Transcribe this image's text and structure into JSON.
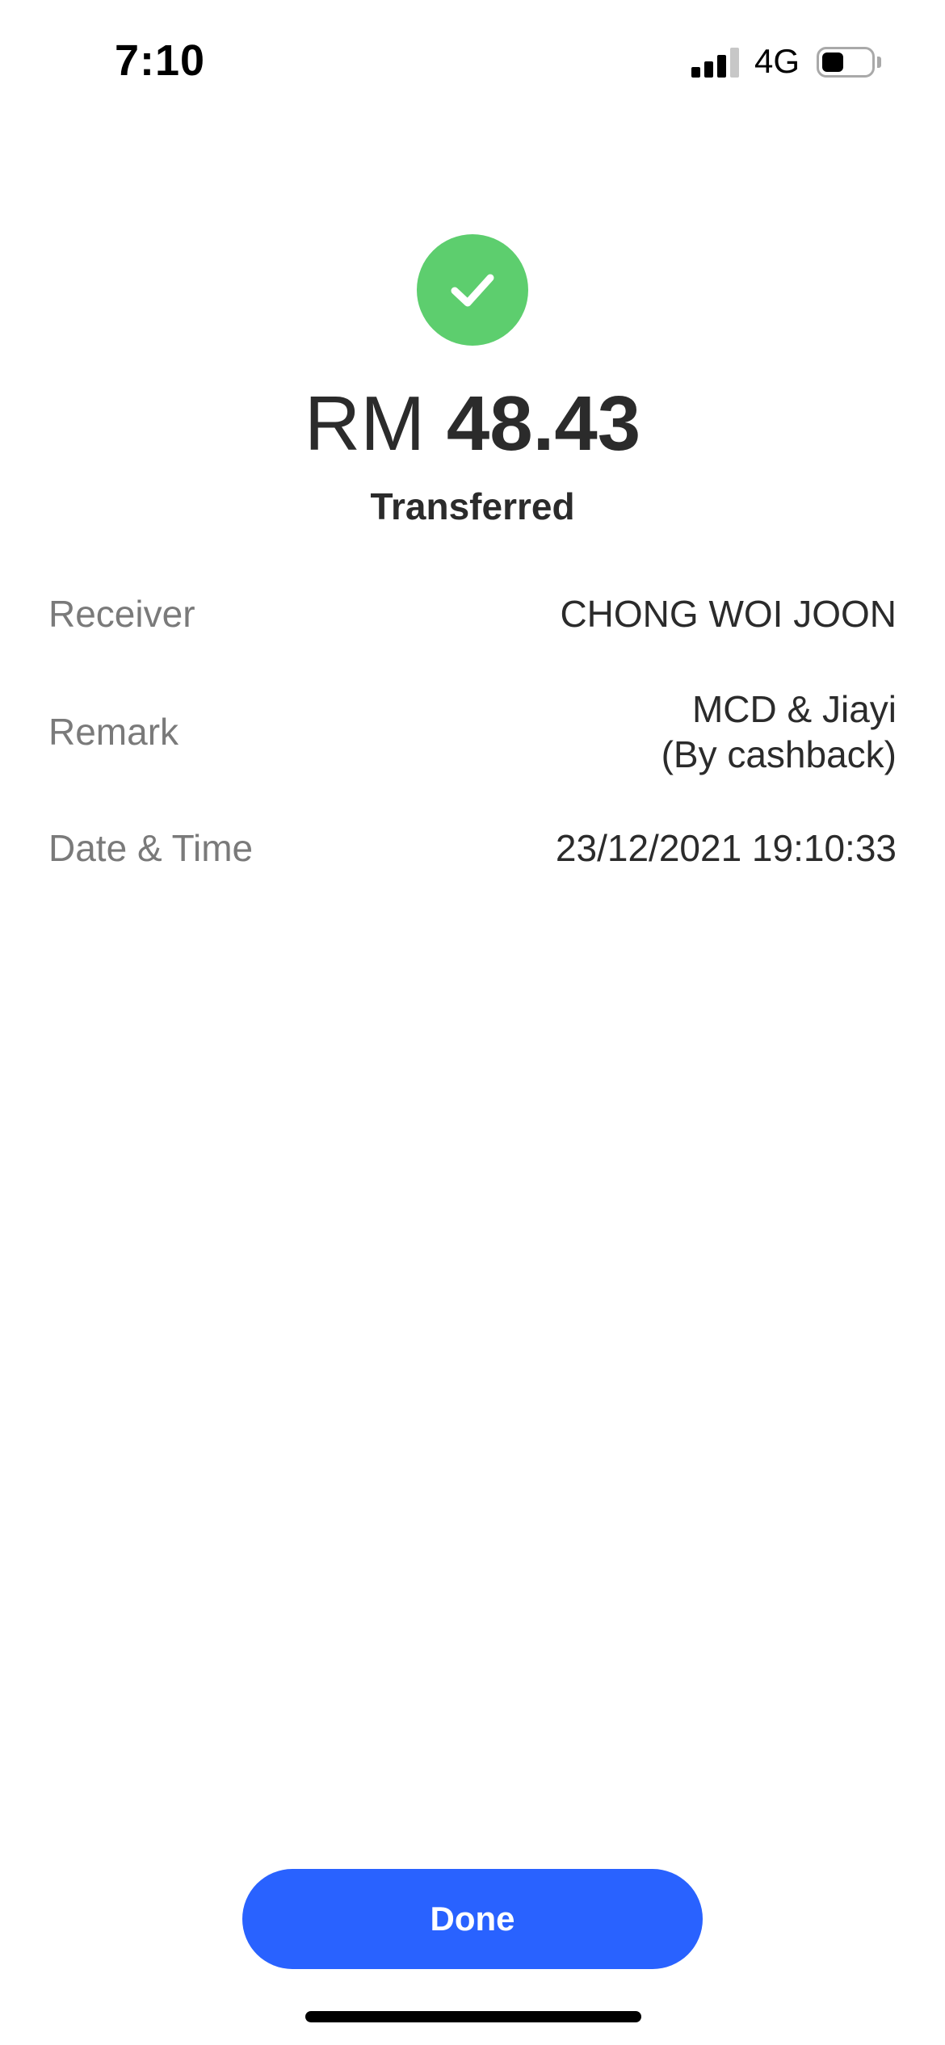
{
  "status_bar": {
    "time": "7:10",
    "network": "4G",
    "signal_bars_active": 3,
    "signal_bars_total": 4,
    "battery_level": 0.45
  },
  "colors": {
    "success": "#5dce6e",
    "primary": "#2962ff"
  },
  "icons": {
    "success": "checkmark-icon"
  },
  "transfer": {
    "currency": "RM",
    "amount": "48.43",
    "status": "Transferred"
  },
  "details": {
    "receiver_label": "Receiver",
    "receiver_value": "CHONG WOI JOON",
    "remark_label": "Remark",
    "remark_line1": "MCD & Jiayi",
    "remark_line2": "(By cashback)",
    "datetime_label": "Date & Time",
    "datetime_value": "23/12/2021 19:10:33"
  },
  "actions": {
    "done_label": "Done"
  }
}
